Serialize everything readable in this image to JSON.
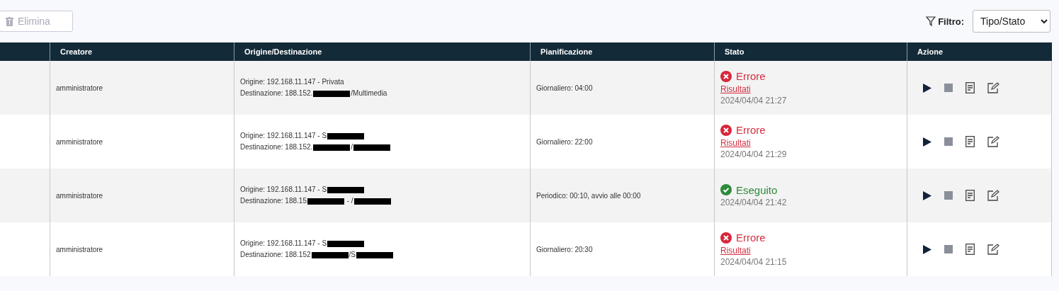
{
  "toolbar": {
    "delete_button": {
      "label": "Elimina",
      "disabled": true
    },
    "filter": {
      "label": "Filtro:",
      "value": "Tipo/Stato"
    }
  },
  "table": {
    "columns": [
      "Creatore",
      "Origine/Destinazione",
      "Pianificazione",
      "Stato",
      "Azione"
    ],
    "rows": [
      {
        "creator": "amministratore",
        "route": [
          [
            {
              "text": "Origine: 192.168.11.147 - Privata"
            }
          ],
          [
            {
              "text": "Destinazione: 188.152."
            },
            {
              "kind": "redaction"
            },
            {
              "text": "/Multimedia"
            }
          ]
        ],
        "schedule": "Giornaliero: 04:00",
        "status": {
          "kind": "error",
          "label": "Errore",
          "link": "Risultati",
          "time": "2024/04/04 21:27"
        }
      },
      {
        "creator": "amministratore",
        "route": [
          [
            {
              "text": "Origine: 192.168.11.147 - S"
            },
            {
              "kind": "redaction"
            }
          ],
          [
            {
              "text": "Destinazione: 188.152."
            },
            {
              "kind": "redaction"
            },
            {
              "text": "/"
            },
            {
              "kind": "redaction"
            }
          ]
        ],
        "schedule": "Giornaliero: 22:00",
        "status": {
          "kind": "error",
          "label": "Errore",
          "link": "Risultati",
          "time": "2024/04/04 21:29"
        }
      },
      {
        "creator": "amministratore",
        "route": [
          [
            {
              "text": "Origine: 192.168.11.147 - S"
            },
            {
              "kind": "redaction"
            }
          ],
          [
            {
              "text": "Destinazione: 188.15"
            },
            {
              "kind": "redaction"
            },
            {
              "text": " - /"
            },
            {
              "kind": "redaction"
            }
          ]
        ],
        "schedule": "Periodico: 00:10, avvio alle 00:00",
        "status": {
          "kind": "success",
          "label": "Eseguito",
          "time": "2024/04/04 21:42"
        }
      },
      {
        "creator": "amministratore",
        "route": [
          [
            {
              "text": "Origine: 192.168.11.147 - S"
            },
            {
              "kind": "redaction"
            }
          ],
          [
            {
              "text": "Destinazione: 188.152"
            },
            {
              "kind": "redaction"
            },
            {
              "text": "/S"
            },
            {
              "kind": "redaction"
            }
          ]
        ],
        "schedule": "Giornaliero: 20:30",
        "status": {
          "kind": "error",
          "label": "Errore",
          "link": "Risultati",
          "time": "2024/04/04 21:15"
        }
      }
    ]
  }
}
